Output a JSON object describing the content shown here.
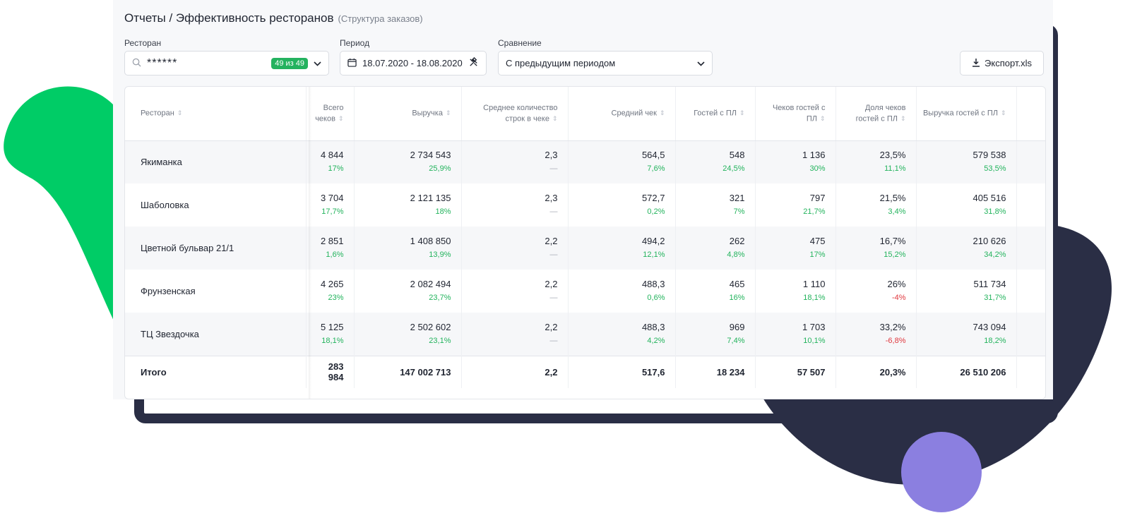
{
  "header": {
    "title": "Отчеты / Эффективность ресторанов",
    "subtitle": "(Структура заказов)"
  },
  "filters": {
    "restaurant": {
      "label": "Ресторан",
      "value": "******",
      "badge": "49 из 49"
    },
    "period": {
      "label": "Период",
      "value": "18.07.2020 - 18.08.2020"
    },
    "comparison": {
      "label": "Сравнение",
      "value": "С предыдущим периодом"
    },
    "export_label": "Экспорт.xls"
  },
  "table": {
    "columns": [
      "Ресторан",
      "Всего чеков",
      "Выручка",
      "Среднее количество строк в чеке",
      "Средний чек",
      "Гостей с ПЛ",
      "Чеков гостей с ПЛ",
      "Доля чеков гостей с ПЛ",
      "Выручка гостей с ПЛ"
    ],
    "rows": [
      {
        "name": "Якиманка",
        "cells": [
          {
            "v": "4 844",
            "d": "17%",
            "t": "pos"
          },
          {
            "v": "2 734 543",
            "d": "25,9%",
            "t": "pos"
          },
          {
            "v": "2,3",
            "d": "—",
            "t": "neu"
          },
          {
            "v": "564,5",
            "d": "7,6%",
            "t": "pos"
          },
          {
            "v": "548",
            "d": "24,5%",
            "t": "pos"
          },
          {
            "v": "1 136",
            "d": "30%",
            "t": "pos"
          },
          {
            "v": "23,5%",
            "d": "11,1%",
            "t": "pos"
          },
          {
            "v": "579 538",
            "d": "53,5%",
            "t": "pos"
          }
        ]
      },
      {
        "name": "Шаболовка",
        "cells": [
          {
            "v": "3 704",
            "d": "17,7%",
            "t": "pos"
          },
          {
            "v": "2 121 135",
            "d": "18%",
            "t": "pos"
          },
          {
            "v": "2,3",
            "d": "—",
            "t": "neu"
          },
          {
            "v": "572,7",
            "d": "0,2%",
            "t": "pos"
          },
          {
            "v": "321",
            "d": "7%",
            "t": "pos"
          },
          {
            "v": "797",
            "d": "21,7%",
            "t": "pos"
          },
          {
            "v": "21,5%",
            "d": "3,4%",
            "t": "pos"
          },
          {
            "v": "405 516",
            "d": "31,8%",
            "t": "pos"
          }
        ]
      },
      {
        "name": "Цветной бульвар 21/1",
        "cells": [
          {
            "v": "2 851",
            "d": "1,6%",
            "t": "pos"
          },
          {
            "v": "1 408 850",
            "d": "13,9%",
            "t": "pos"
          },
          {
            "v": "2,2",
            "d": "—",
            "t": "neu"
          },
          {
            "v": "494,2",
            "d": "12,1%",
            "t": "pos"
          },
          {
            "v": "262",
            "d": "4,8%",
            "t": "pos"
          },
          {
            "v": "475",
            "d": "17%",
            "t": "pos"
          },
          {
            "v": "16,7%",
            "d": "15,2%",
            "t": "pos"
          },
          {
            "v": "210 626",
            "d": "34,2%",
            "t": "pos"
          }
        ]
      },
      {
        "name": "Фрунзенская",
        "cells": [
          {
            "v": "4 265",
            "d": "23%",
            "t": "pos"
          },
          {
            "v": "2 082 494",
            "d": "23,7%",
            "t": "pos"
          },
          {
            "v": "2,2",
            "d": "—",
            "t": "neu"
          },
          {
            "v": "488,3",
            "d": "0,6%",
            "t": "pos"
          },
          {
            "v": "465",
            "d": "16%",
            "t": "pos"
          },
          {
            "v": "1 110",
            "d": "18,1%",
            "t": "pos"
          },
          {
            "v": "26%",
            "d": "-4%",
            "t": "neg"
          },
          {
            "v": "511 734",
            "d": "31,7%",
            "t": "pos"
          }
        ]
      },
      {
        "name": "ТЦ Звездочка",
        "cells": [
          {
            "v": "5 125",
            "d": "18,1%",
            "t": "pos"
          },
          {
            "v": "2 502 602",
            "d": "23,1%",
            "t": "pos"
          },
          {
            "v": "2,2",
            "d": "—",
            "t": "neu"
          },
          {
            "v": "488,3",
            "d": "4,2%",
            "t": "pos"
          },
          {
            "v": "969",
            "d": "7,4%",
            "t": "pos"
          },
          {
            "v": "1 703",
            "d": "10,1%",
            "t": "pos"
          },
          {
            "v": "33,2%",
            "d": "-6,8%",
            "t": "neg"
          },
          {
            "v": "743 094",
            "d": "18,2%",
            "t": "pos"
          }
        ]
      }
    ],
    "total": {
      "label": "Итого",
      "cells": [
        "283 984",
        "147 002 713",
        "2,2",
        "517,6",
        "18 234",
        "57 507",
        "20,3%",
        "26 510 206"
      ]
    }
  },
  "colors": {
    "accent_green": "#24b25f",
    "positive": "#22b35c",
    "negative": "#e0383e",
    "frame_dark": "#2a2e45",
    "blob_green": "#00cc66",
    "circle_purple": "#8b7fe0"
  },
  "icons": [
    "search-icon",
    "chevron-down-icon",
    "calendar-icon",
    "hammer-icon",
    "download-icon",
    "sort-icon"
  ]
}
